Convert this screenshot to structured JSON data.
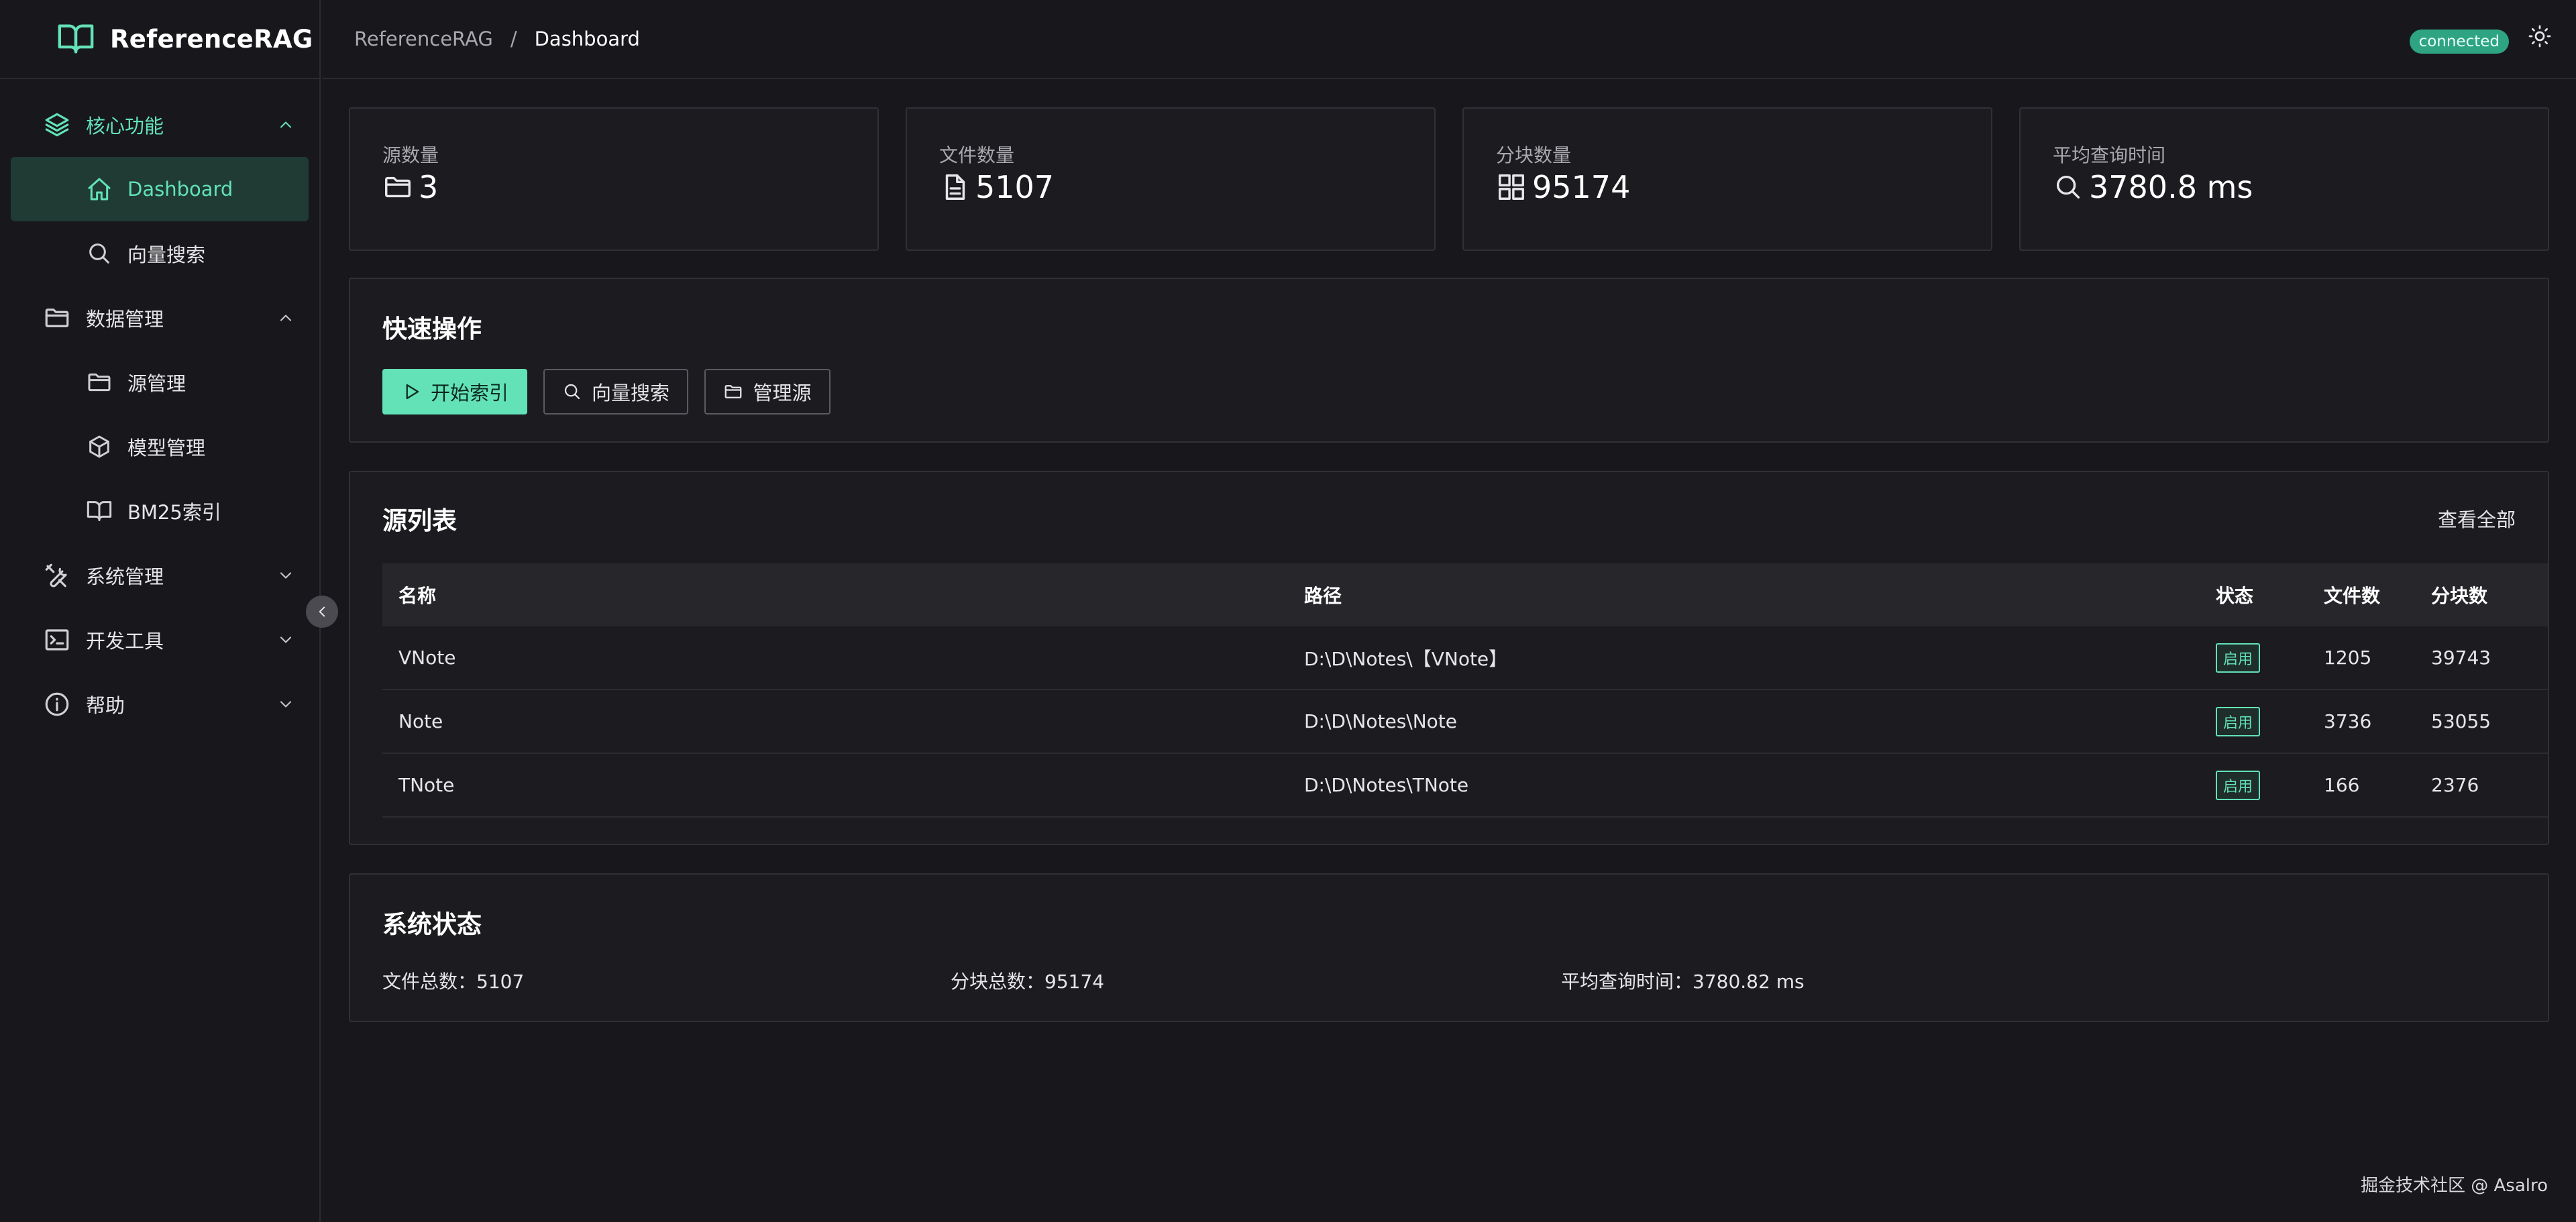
{
  "app": {
    "name": "ReferenceRAG"
  },
  "header": {
    "breadcrumb": [
      "ReferenceRAG",
      "Dashboard"
    ],
    "breadcrumb_sep": "/",
    "connection_status": "connected"
  },
  "sidebar": {
    "groups": [
      {
        "label": "核心功能",
        "icon": "layers-icon",
        "expanded": true,
        "items": [
          {
            "label": "Dashboard",
            "icon": "home-icon",
            "active": true
          },
          {
            "label": "向量搜索",
            "icon": "search-icon"
          }
        ]
      },
      {
        "label": "数据管理",
        "icon": "folder-icon",
        "expanded": true,
        "items": [
          {
            "label": "源管理",
            "icon": "folder-icon"
          },
          {
            "label": "模型管理",
            "icon": "cube-icon"
          },
          {
            "label": "BM25索引",
            "icon": "book-icon"
          }
        ]
      },
      {
        "label": "系统管理",
        "icon": "tools-icon",
        "expanded": false
      },
      {
        "label": "开发工具",
        "icon": "terminal-icon",
        "expanded": false
      },
      {
        "label": "帮助",
        "icon": "info-icon",
        "expanded": false
      }
    ]
  },
  "stats": [
    {
      "label": "源数量",
      "value": "3",
      "icon": "folder-icon"
    },
    {
      "label": "文件数量",
      "value": "5107",
      "icon": "file-icon"
    },
    {
      "label": "分块数量",
      "value": "95174",
      "icon": "grid-icon"
    },
    {
      "label": "平均查询时间",
      "value": "3780.8 ms",
      "icon": "search-icon"
    }
  ],
  "quick_actions": {
    "title": "快速操作",
    "buttons": [
      {
        "label": "开始索引",
        "icon": "play-icon",
        "primary": true
      },
      {
        "label": "向量搜索",
        "icon": "search-icon"
      },
      {
        "label": "管理源",
        "icon": "folder-icon"
      }
    ]
  },
  "sources": {
    "title": "源列表",
    "view_all": "查看全部",
    "columns": [
      "名称",
      "路径",
      "状态",
      "文件数",
      "分块数"
    ],
    "rows": [
      {
        "name": "VNote",
        "path": "D:\\D\\Notes\\【VNote】",
        "status": "启用",
        "files": "1205",
        "chunks": "39743"
      },
      {
        "name": "Note",
        "path": "D:\\D\\Notes\\Note",
        "status": "启用",
        "files": "3736",
        "chunks": "53055"
      },
      {
        "name": "TNote",
        "path": "D:\\D\\Notes\\TNote",
        "status": "启用",
        "files": "166",
        "chunks": "2376"
      }
    ]
  },
  "system_status": {
    "title": "系统状态",
    "items": [
      "文件总数：5107",
      "分块总数：95174",
      "平均查询时间：3780.82 ms"
    ]
  },
  "footer": {
    "text": "掘金技术社区 @ Asalro"
  },
  "colors": {
    "accent": "#63e2b7",
    "background": "#18181c",
    "card": "#1c1c20",
    "active_bg": "#1f3b34"
  }
}
